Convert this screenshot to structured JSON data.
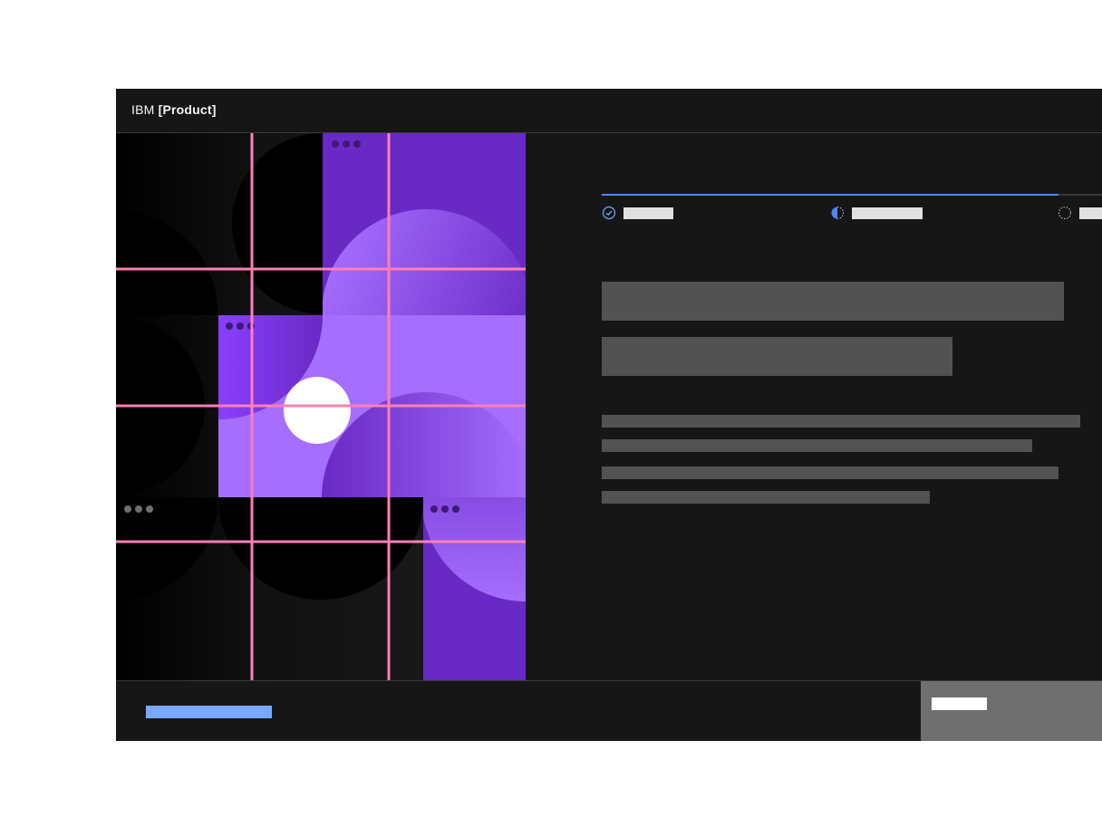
{
  "header": {
    "brand_prefix": "IBM",
    "brand_product": "[Product]"
  },
  "progress": {
    "fraction_complete": 0.9,
    "steps": [
      {
        "state": "complete",
        "icon": "checkmark-circle-icon",
        "label": ""
      },
      {
        "state": "current",
        "icon": "half-circle-icon",
        "label": ""
      },
      {
        "state": "incomplete",
        "icon": "dashed-circle-icon",
        "label": ""
      }
    ]
  },
  "content": {
    "title_lines": [
      "",
      ""
    ],
    "paragraph_lines": [
      "",
      "",
      "",
      ""
    ]
  },
  "footer": {
    "link_label": "",
    "primary_button_label": ""
  },
  "colors": {
    "shell_bg": "#161616",
    "accent_blue": "#4589ff",
    "link_blue": "#78a9ff",
    "purple": "#6929c4",
    "light_purple": "#a56eff",
    "grid_pink": "#ff7eb6",
    "placeholder_gray": "#525252",
    "button_gray": "#6f6f6f"
  }
}
